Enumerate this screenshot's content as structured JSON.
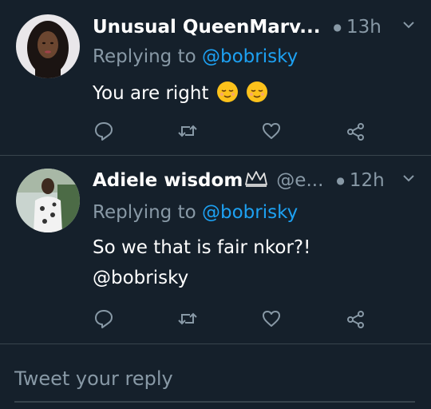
{
  "tweets": [
    {
      "author_name": "Unusual QueenMarv...",
      "handle": "",
      "time": "13h",
      "reply_label": "Replying to",
      "reply_mention": "@bobrisky",
      "text": "You are right"
    },
    {
      "author_name": "Adiele wisdom",
      "handle": "@e...",
      "time": "12h",
      "reply_label": "Replying to",
      "reply_mention": "@bobrisky",
      "text_line1": "So we that is fair nkor?!",
      "text_line2": "@bobrisky"
    }
  ],
  "compose": {
    "placeholder": "Tweet your reply"
  },
  "colors": {
    "background": "#15202b",
    "accent": "#1da1f2",
    "secondary_text": "#8899a6",
    "divider": "#38444d"
  }
}
